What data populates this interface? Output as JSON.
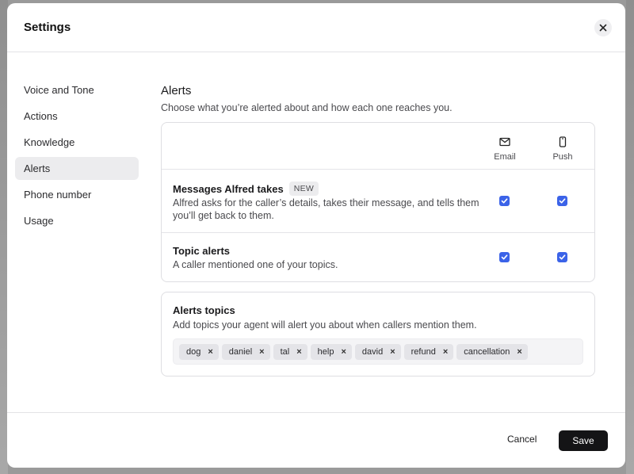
{
  "dialog": {
    "title": "Settings",
    "close_icon": "close-icon"
  },
  "sidebar": {
    "items": [
      {
        "label": "Voice and Tone",
        "active": false
      },
      {
        "label": "Actions",
        "active": false
      },
      {
        "label": "Knowledge",
        "active": false
      },
      {
        "label": "Alerts",
        "active": true
      },
      {
        "label": "Phone number",
        "active": false
      },
      {
        "label": "Usage",
        "active": false
      }
    ]
  },
  "alerts": {
    "title": "Alerts",
    "description": "Choose what you’re alerted about and how each one reaches you.",
    "columns": [
      {
        "label": "Email",
        "icon": "mail-icon"
      },
      {
        "label": "Push",
        "icon": "phone-icon"
      }
    ],
    "rows": [
      {
        "title": "Messages Alfred takes",
        "badge": "NEW",
        "description": "Alfred asks for the caller’s details, takes their message, and tells them you’ll get back to them.",
        "email": true,
        "push": true
      },
      {
        "title": "Topic alerts",
        "description": "A caller mentioned one of your topics.",
        "email": true,
        "push": true
      }
    ]
  },
  "topics": {
    "title": "Alerts topics",
    "description": "Add topics your agent will alert you about when callers mention them.",
    "tags": [
      "dog",
      "daniel",
      "tal",
      "help",
      "david",
      "refund",
      "cancellation"
    ]
  },
  "footer": {
    "cancel_label": "Cancel",
    "save_label": "Save"
  },
  "colors": {
    "accent": "#3b63e8",
    "primary_button": "#141416",
    "active_nav": "#ececee"
  }
}
